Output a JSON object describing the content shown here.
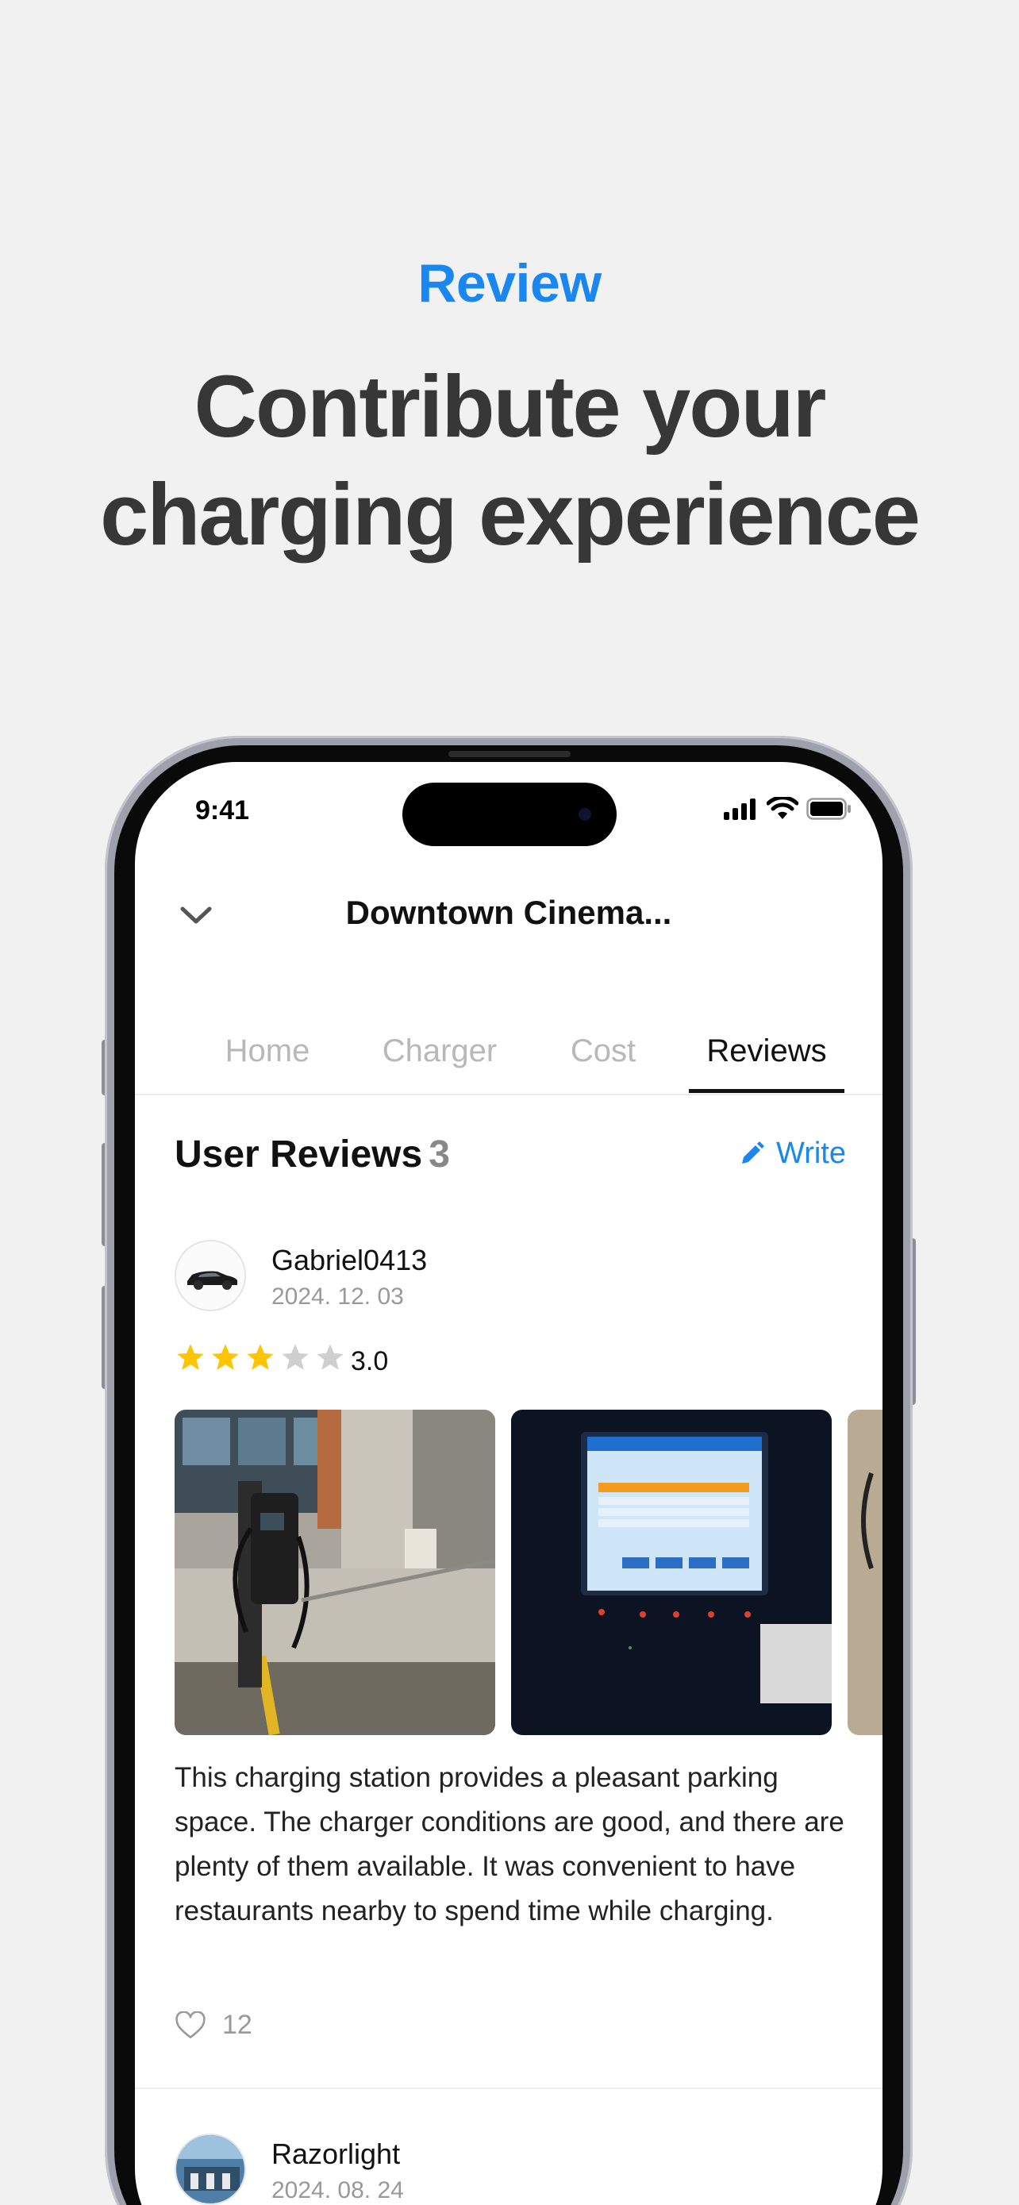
{
  "promo": {
    "eyebrow": "Review",
    "headline_line1": "Contribute your",
    "headline_line2": "charging experience"
  },
  "status_bar": {
    "time": "9:41",
    "icons": [
      "signal-icon",
      "wifi-icon",
      "battery-icon"
    ]
  },
  "header": {
    "title": "Downtown Cinema...",
    "back_icon": "chevron-down-icon"
  },
  "tabs": [
    {
      "label": "Home",
      "active": false
    },
    {
      "label": "Charger",
      "active": false
    },
    {
      "label": "Cost",
      "active": false
    },
    {
      "label": "Reviews",
      "active": true
    }
  ],
  "reviews_section": {
    "title": "User Reviews",
    "count": "3",
    "write_label": "Write"
  },
  "reviews": [
    {
      "username": "Gabriel0413",
      "date": "2024. 12. 03",
      "rating": 3,
      "rating_label": "3.0",
      "text": "This charging station provides a pleasant parking space. The charger conditions are good, and there are plenty of them available. It was convenient to have restaurants nearby to spend time while charging.",
      "likes": "12"
    },
    {
      "username": "Razorlight",
      "date": "2024. 08. 24"
    }
  ],
  "colors": {
    "accent": "#1a86f0",
    "star_on": "#ffc400",
    "star_off": "#cfcfcf",
    "headline": "#373737"
  }
}
